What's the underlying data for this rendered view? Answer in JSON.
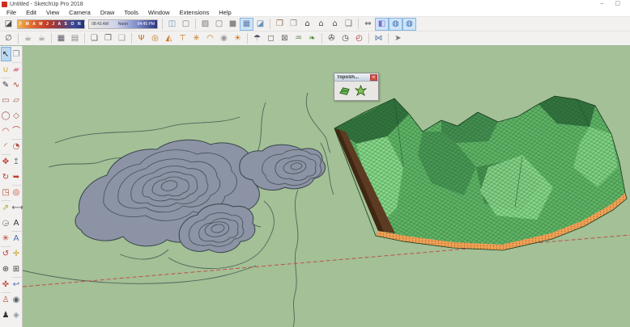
{
  "window": {
    "title": "Untitled - SketchUp Pro 2018",
    "minimize": "–",
    "maximize": "▢"
  },
  "menubar": {
    "items": [
      {
        "label": "File"
      },
      {
        "label": "Edit"
      },
      {
        "label": "View"
      },
      {
        "label": "Camera"
      },
      {
        "label": "Draw"
      },
      {
        "label": "Tools"
      },
      {
        "label": "Window"
      },
      {
        "label": "Extensions"
      },
      {
        "label": "Help"
      }
    ]
  },
  "shadows": {
    "months": "J F M A M J J A S O N D",
    "time_start": "08:43 AM",
    "time_noon": "Noon",
    "time_end": "04:45 PM"
  },
  "toolbars": {
    "rowA": {
      "shadow_toggle": [
        {
          "icon": "shadow-toggle",
          "color": "#4a4a4a"
        }
      ],
      "style_group1": [
        {
          "icon": "xray",
          "color": "#6d93b8"
        },
        {
          "icon": "wireframe",
          "color": "#777777"
        }
      ],
      "style_group2": [
        {
          "icon": "back-edges",
          "color": "#777777"
        },
        {
          "icon": "hidden-line",
          "color": "#777777"
        },
        {
          "icon": "shaded",
          "color": "#8a8a8a"
        },
        {
          "icon": "shaded-textures",
          "color": "#5b7fa6",
          "selected": true
        },
        {
          "icon": "monochrome",
          "color": "#6d93b8"
        }
      ],
      "warehouse": [
        {
          "icon": "get-models",
          "color": "#8a6a4a"
        },
        {
          "icon": "components-book",
          "color": "#8a8a84"
        },
        {
          "icon": "home",
          "color": "#444444"
        },
        {
          "icon": "share-model",
          "color": "#555555"
        },
        {
          "icon": "share-component",
          "color": "#555555"
        },
        {
          "icon": "extension-warehouse",
          "color": "#6a6a6a"
        }
      ],
      "geo": [
        {
          "icon": "swap-arrows",
          "color": "#555555"
        },
        {
          "icon": "section-plane-display",
          "color": "#7a6fd0",
          "selected": true
        },
        {
          "icon": "add-location",
          "color": "#3a6ab0",
          "selected": true
        },
        {
          "icon": "show-terrain",
          "color": "#3a6ab0",
          "selected": true
        }
      ]
    },
    "rowB": {
      "g1": [
        {
          "icon": "circle-slash",
          "color": "#555555"
        }
      ],
      "g2": [
        {
          "icon": "teapot",
          "color": "#7a6a58"
        },
        {
          "icon": "teapot-export",
          "color": "#7a6a58"
        }
      ],
      "g3": [
        {
          "icon": "watermark-dark",
          "color": "#5a5a66"
        },
        {
          "icon": "watermark-frame",
          "color": "#8a8a8a"
        }
      ],
      "g4": [
        {
          "icon": "window",
          "color": "#666666"
        },
        {
          "icon": "window-image",
          "color": "#666666"
        },
        {
          "icon": "window-lock",
          "color": "#9a9a9a"
        }
      ],
      "g5": [
        {
          "icon": "topo-contours",
          "color": "#c8761d"
        },
        {
          "icon": "topo-ring",
          "color": "#c8761d"
        },
        {
          "icon": "topo-flag",
          "color": "#c8761d"
        },
        {
          "icon": "topo-stamp",
          "color": "#c8761d"
        },
        {
          "icon": "topo-drape",
          "color": "#c8761d"
        },
        {
          "icon": "topo-dome",
          "color": "#c8761d"
        },
        {
          "icon": "topo-target",
          "color": "#9a9a9a"
        },
        {
          "icon": "topo-sun",
          "color": "#c8761d"
        }
      ],
      "g6": [
        {
          "icon": "parasol",
          "color": "#555566"
        },
        {
          "icon": "cube",
          "color": "#666666"
        },
        {
          "icon": "cube-delete",
          "color": "#666666"
        },
        {
          "icon": "grass",
          "color": "#5a8a4a"
        },
        {
          "icon": "leaf",
          "color": "#4a8a3a"
        }
      ],
      "g7": [
        {
          "icon": "compass",
          "color": "#44464a"
        },
        {
          "icon": "compass-small",
          "color": "#44464a"
        },
        {
          "icon": "speedometer",
          "color": "#b03030"
        }
      ],
      "g8": [
        {
          "icon": "mirror",
          "color": "#5a7ab5"
        }
      ],
      "g9": [
        {
          "icon": "cursor",
          "color": "#777777"
        }
      ]
    }
  },
  "sidebar": {
    "tools": [
      {
        "icon": "select",
        "color": "#1a1a1a",
        "selected": true
      },
      {
        "icon": "make-component",
        "color": "#8a8f98"
      },
      {
        "icon": "paint-bucket",
        "color": "#c9a227"
      },
      {
        "icon": "eraser",
        "color": "#e08ca0"
      },
      {
        "icon": "line",
        "color": "#333333"
      },
      {
        "icon": "freehand",
        "color": "#a04828"
      },
      {
        "icon": "rectangle",
        "color": "#9a5a50"
      },
      {
        "icon": "rotated-rectangle",
        "color": "#9a5a50"
      },
      {
        "icon": "circle",
        "color": "#9a5a50"
      },
      {
        "icon": "polygon",
        "color": "#9a5a50"
      },
      {
        "icon": "arc",
        "color": "#b04a40"
      },
      {
        "icon": "two-point-arc",
        "color": "#b04a40"
      },
      {
        "icon": "three-point-arc",
        "color": "#b04a40"
      },
      {
        "icon": "pie",
        "color": "#b04a40"
      },
      {
        "icon": "move",
        "color": "#c0392b"
      },
      {
        "icon": "push-pull",
        "color": "#6a7a8a"
      },
      {
        "icon": "rotate",
        "color": "#c0392b"
      },
      {
        "icon": "follow-me",
        "color": "#c0392b"
      },
      {
        "icon": "scale",
        "color": "#b05030"
      },
      {
        "icon": "offset",
        "color": "#c0392b"
      },
      {
        "icon": "tape-measure",
        "color": "#b0a030"
      },
      {
        "icon": "dimension",
        "color": "#555555"
      },
      {
        "icon": "protractor",
        "color": "#777777"
      },
      {
        "icon": "text",
        "color": "#333333"
      },
      {
        "icon": "axes",
        "color": "#c0392b"
      },
      {
        "icon": "three-d-text",
        "color": "#4a6ab0"
      },
      {
        "icon": "orbit",
        "color": "#c0392b"
      },
      {
        "icon": "pan",
        "color": "#c9a227"
      },
      {
        "icon": "zoom",
        "color": "#444444"
      },
      {
        "icon": "zoom-window",
        "color": "#444444"
      },
      {
        "icon": "zoom-extents",
        "color": "#c0392b"
      },
      {
        "icon": "zoom-previous",
        "color": "#4a6ab0"
      },
      {
        "icon": "position-camera",
        "color": "#b05030"
      },
      {
        "icon": "look-around",
        "color": "#556066"
      },
      {
        "icon": "walk",
        "color": "#333333"
      },
      {
        "icon": "section-plane",
        "color": "#8a9aa8"
      }
    ]
  },
  "palette": {
    "title": "TopoSh...",
    "close": "✕"
  },
  "colors": {
    "canvas_bg": "#a3c096",
    "contour_fill": "#8b93a4",
    "contour_stroke": "#39454e",
    "contour_ring": "#434f58",
    "contour_line": "#50655b",
    "axis_red": "#c0504a",
    "terrain_base": "#5fb465",
    "terrain_dark": "#2e6b3a",
    "terrain_mid": "#3f8a4d",
    "terrain_light": "#8ede8e",
    "terrain_outline": "#17381d",
    "mesh_line": "#1d4f2a",
    "terrain_side": "#5d3b22",
    "terrain_side_dark": "#3f2714",
    "terrain_skirt": "#efa057",
    "skirt_dot": "#b06a24"
  }
}
